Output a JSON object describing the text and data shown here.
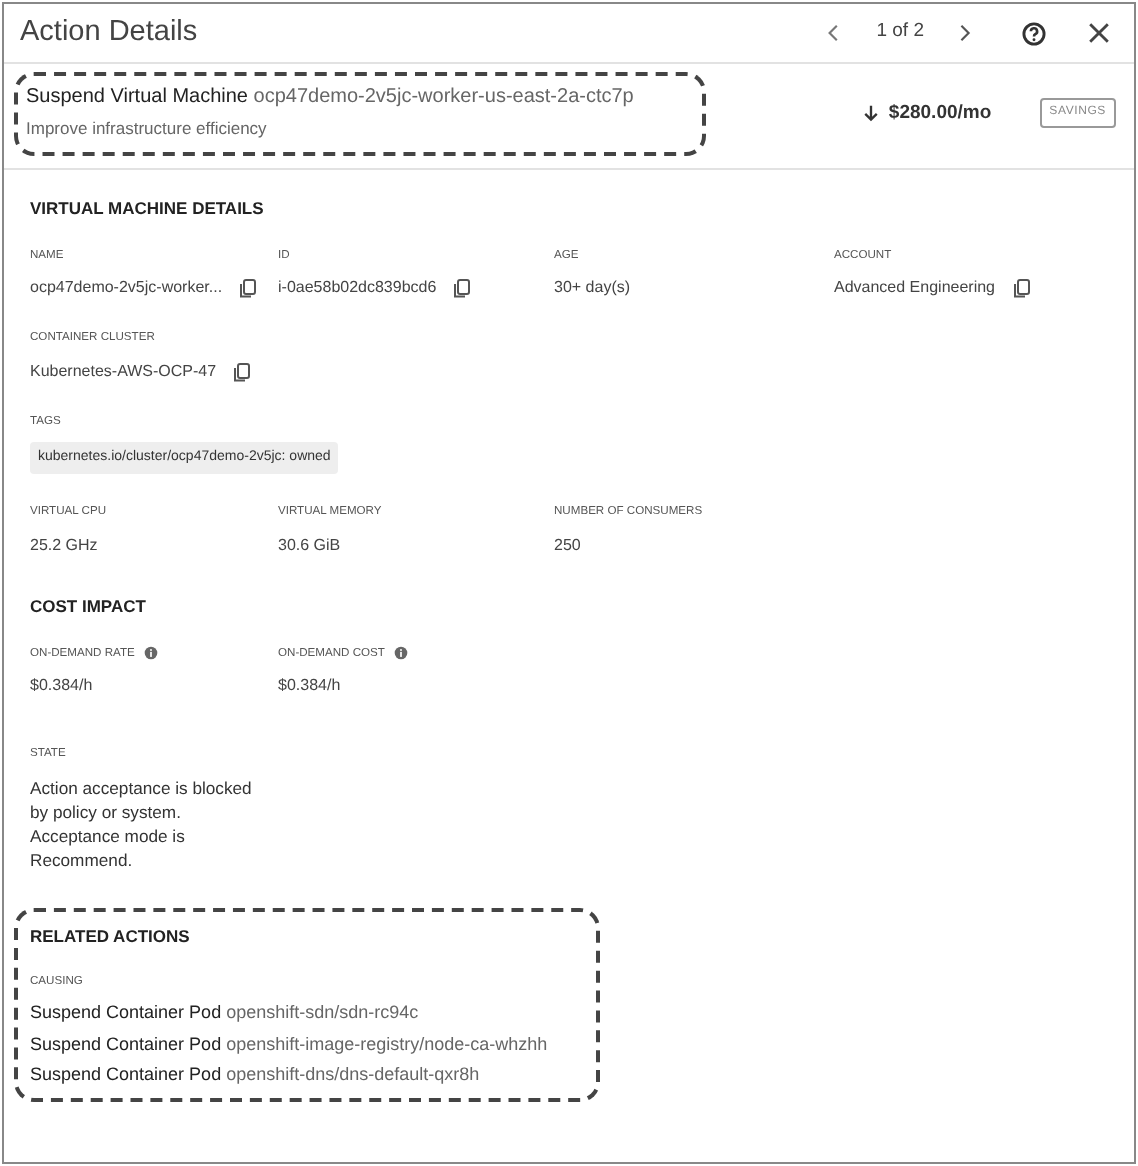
{
  "header": {
    "title": "Action Details",
    "pager": "1 of 2"
  },
  "action": {
    "verb": "Suspend Virtual Machine",
    "target": "ocp47demo-2v5jc-worker-us-east-2a-ctc7p",
    "subtitle": "Improve infrastructure efficiency",
    "highlighted": true,
    "savings": "$280.00/mo",
    "badge": "SAVINGS"
  },
  "sections": [
    {
      "title": "VIRTUAL MACHINE DETAILS",
      "rows": [
        [
          {
            "label": "NAME",
            "value": "ocp47demo-2v5jc-worker...",
            "copy": true
          },
          {
            "label": "ID",
            "value": "i-0ae58b02dc839bcd6",
            "copy": true
          },
          {
            "label": "AGE",
            "value": "30+ day(s)"
          },
          {
            "label": "ACCOUNT",
            "value": "Advanced Engineering",
            "copy": true
          }
        ],
        [
          {
            "label": "CONTAINER CLUSTER",
            "value": "Kubernetes-AWS-OCP-47",
            "copy": true
          }
        ],
        [
          {
            "label": "TAGS",
            "value": "kubernetes.io/cluster/ocp47demo-2v5jc: owned",
            "kind": "tag"
          }
        ],
        [
          {
            "label": "VIRTUAL CPU",
            "value": "25.2 GHz"
          },
          {
            "label": "VIRTUAL MEMORY",
            "value": "30.6 GiB"
          },
          {
            "label": "NUMBER OF CONSUMERS",
            "value": "250"
          }
        ]
      ]
    },
    {
      "title": "COST IMPACT",
      "rows": [
        [
          {
            "label": "ON-DEMAND RATE",
            "value": "$0.384/h",
            "info": true
          },
          {
            "label": "ON-DEMAND COST",
            "value": "$0.384/h",
            "info": true
          }
        ],
        [
          {
            "label": "STATE",
            "value": "Action acceptance is blocked by policy or system. Acceptance mode is Recommend.",
            "kind": "para"
          }
        ]
      ]
    },
    {
      "title": "RELATED ACTIONS",
      "highlighted": true,
      "groups": [
        {
          "label": "CAUSING",
          "items": [
            {
              "verb": "Suspend Container Pod",
              "target": "openshift-sdn/sdn-rc94c"
            },
            {
              "verb": "Suspend Container Pod",
              "target": "openshift-image-registry/node-ca-whzhh"
            },
            {
              "verb": "Suspend Container Pod",
              "target": "openshift-dns/dns-default-qxr8h"
            }
          ]
        }
      ]
    }
  ]
}
